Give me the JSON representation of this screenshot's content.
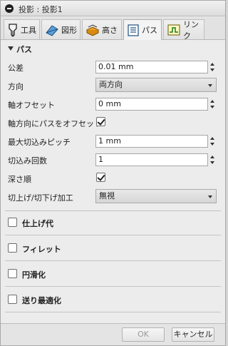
{
  "dialog": {
    "title": "投影 : 投影1"
  },
  "tabs": [
    {
      "label": "工具",
      "icon": "tool-icon"
    },
    {
      "label": "図形",
      "icon": "geometry-icon"
    },
    {
      "label": "高さ",
      "icon": "heights-icon"
    },
    {
      "label": "パス",
      "icon": "passes-icon",
      "active": true
    },
    {
      "label": "リンク",
      "icon": "linking-icon"
    }
  ],
  "passes": {
    "heading": "パス",
    "tolerance": {
      "label": "公差",
      "value": "0.01 mm"
    },
    "direction": {
      "label": "方向",
      "value": "両方向"
    },
    "axial_offset": {
      "label": "軸オフセット",
      "value": "0 mm"
    },
    "offset_passes": {
      "label": "軸方向にパスをオフセット",
      "checked": true
    },
    "max_stepdown": {
      "label": "最大切込みピッチ",
      "value": "1 mm"
    },
    "stepdown_count": {
      "label": "切込み回数",
      "value": "1"
    },
    "depth_first": {
      "label": "深さ順",
      "checked": true
    },
    "ramp": {
      "label": "切上げ/切下げ加工",
      "value": "無視"
    }
  },
  "sections": {
    "stock_to_leave": {
      "label": "仕上げ代",
      "checked": false
    },
    "fillet": {
      "label": "フィレット",
      "checked": false
    },
    "smoothing": {
      "label": "円滑化",
      "checked": false
    },
    "feed_optimization": {
      "label": "送り最適化",
      "checked": false
    }
  },
  "footer": {
    "ok": "OK",
    "cancel": "キャンセル"
  }
}
